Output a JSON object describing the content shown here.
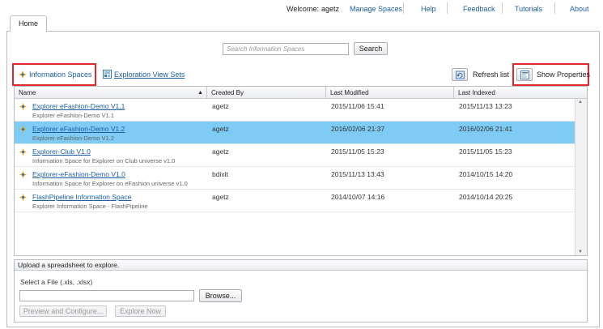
{
  "header": {
    "welcome_label": "Welcome:",
    "user": "agetz",
    "nav": [
      "Manage Spaces",
      "Help",
      "Feedback",
      "Tutorials",
      "About"
    ]
  },
  "tab": {
    "label": "Home"
  },
  "search": {
    "placeholder": "Search Information Spaces",
    "button": "Search"
  },
  "toolbar": {
    "info_spaces": "Information Spaces",
    "exploration_sets": "Exploration View Sets",
    "refresh": "Refresh list",
    "show_properties": "Show Properties"
  },
  "grid": {
    "columns": [
      "Name",
      "Created By",
      "Last Modified",
      "Last Indexed"
    ],
    "rows": [
      {
        "name": "Explorer eFashion-Demo V1.1",
        "desc": "Explorer eFashion-Demo V1.1",
        "created_by": "agetz",
        "modified": "2015/11/06 15:41",
        "indexed": "2015/11/13 13:23",
        "selected": false
      },
      {
        "name": "Explorer eFashion-Demo V1.2",
        "desc": "Explorer eFashion-Demo V1.2",
        "created_by": "agetz",
        "modified": "2016/02/06 21:37",
        "indexed": "2016/02/06 21:41",
        "selected": true
      },
      {
        "name": "Explorer-Club V1.0",
        "desc": "Information Space for Explorer on Club universe v1.0",
        "created_by": "agetz",
        "modified": "2015/11/05 15:23",
        "indexed": "2015/11/05 15:23",
        "selected": false
      },
      {
        "name": "Explorer-eFashion-Demo V1.0",
        "desc": "Information Space for Explorer on eFashion universe v1.0",
        "created_by": "bdixit",
        "modified": "2015/11/13 13:43",
        "indexed": "2014/10/15 14:20",
        "selected": false
      },
      {
        "name": "FlashPipeline Information Space",
        "desc": "Explorer Information Space - FlashPipeline",
        "created_by": "agetz",
        "modified": "2014/10/07 14:16",
        "indexed": "2014/10/14 20:25",
        "selected": false
      }
    ]
  },
  "upload": {
    "title": "Upload a spreadsheet to explore.",
    "file_label": "Select a File (.xls, .xlsx)",
    "file_value": "",
    "browse": "Browse...",
    "preview": "Preview and Configure...",
    "explore": "Explore Now"
  },
  "colors": {
    "selected_row": "#7ecbf5",
    "highlight_box": "#e0282e",
    "link": "#1a5fa8"
  }
}
